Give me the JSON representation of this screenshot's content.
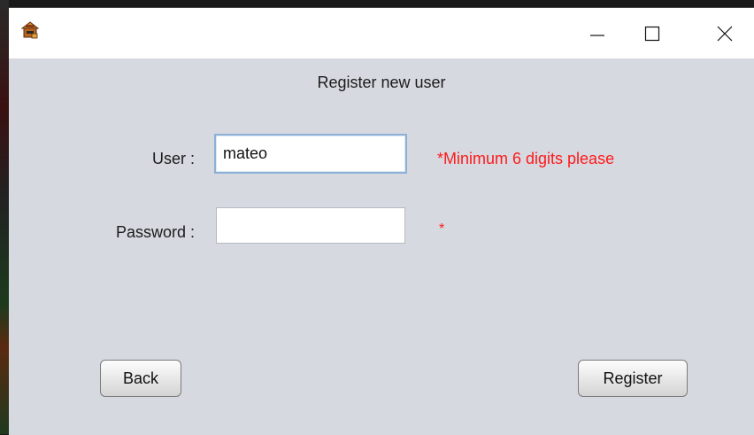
{
  "window": {
    "title": "",
    "app_icon": "app-logo-icon",
    "controls": {
      "minimize_icon": "minimize-icon",
      "maximize_icon": "maximize-icon",
      "close_icon": "close-icon"
    }
  },
  "form": {
    "heading": "Register new user",
    "user": {
      "label": "User :",
      "value": "mateo",
      "hint": "*Minimum 6 digits please"
    },
    "password": {
      "label": "Password :",
      "value": "",
      "hint": "*"
    }
  },
  "buttons": {
    "back": "Back",
    "register": "Register"
  },
  "colors": {
    "window_background": "#d6d9e0",
    "hint_text": "#ff1a1a",
    "focus_border": "#8fb0d6"
  }
}
